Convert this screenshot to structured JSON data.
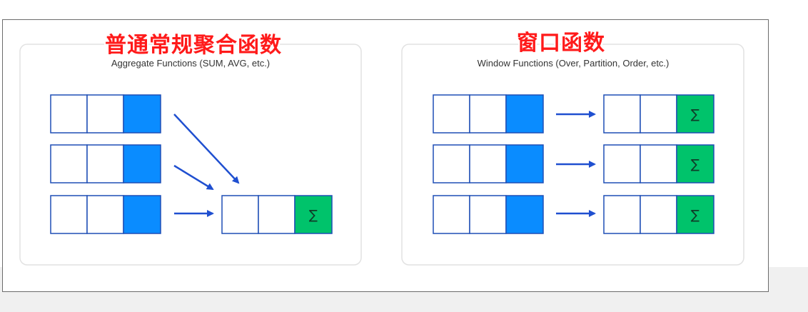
{
  "panels": [
    {
      "overlay_title": "普通常规聚合函数",
      "title": "Aggregate Functions (SUM, AVG, etc.)",
      "result_symbol": "∑"
    },
    {
      "overlay_title": "窗口函数",
      "title": "Window Functions (Over, Partition, Order, etc.)",
      "result_symbols": [
        "∑",
        "∑",
        "∑"
      ]
    }
  ],
  "colors": {
    "cell_border": "#1f4fb5",
    "cell_highlight": "#0a8cff",
    "result_cell": "#00c36b",
    "arrow": "#1f4fd0",
    "overlay_title": "#ff1a1a"
  },
  "icons": {
    "result": "sigma-icon"
  }
}
